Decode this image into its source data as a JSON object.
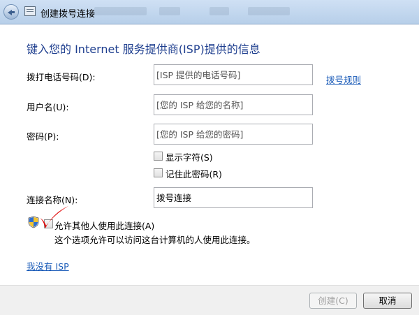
{
  "window": {
    "title": "创建拨号连接"
  },
  "heading": "键入您的 Internet 服务提供商(ISP)提供的信息",
  "form": {
    "phone": {
      "label": "拨打电话号码(D):",
      "placeholder": "[ISP 提供的电话号码]"
    },
    "dial_rules_link": "拨号规则",
    "username": {
      "label": "用户名(U):",
      "placeholder": "[您的 ISP 给您的名称]"
    },
    "password": {
      "label": "密码(P):",
      "placeholder": "[您的 ISP 给您的密码]"
    },
    "show_chars": {
      "label": "显示字符(S)",
      "checked": false
    },
    "remember_password": {
      "label": "记住此密码(R)",
      "checked": false
    },
    "connection_name": {
      "label": "连接名称(N):",
      "value": "拨号连接"
    },
    "allow_others": {
      "label": "允许其他人使用此连接(A)",
      "description": "这个选项允许可以访问这台计算机的人使用此连接。",
      "checked": false
    }
  },
  "no_isp_link": "我没有 ISP",
  "buttons": {
    "create": "创建(C)",
    "cancel": "取消"
  },
  "colors": {
    "heading": "#1f3f8f",
    "link": "#1a5bb8",
    "red_check": "#e00000"
  },
  "icons": {
    "shield": "uac-shield-icon",
    "back": "back-arrow-icon",
    "title": "dialup-window-icon"
  }
}
